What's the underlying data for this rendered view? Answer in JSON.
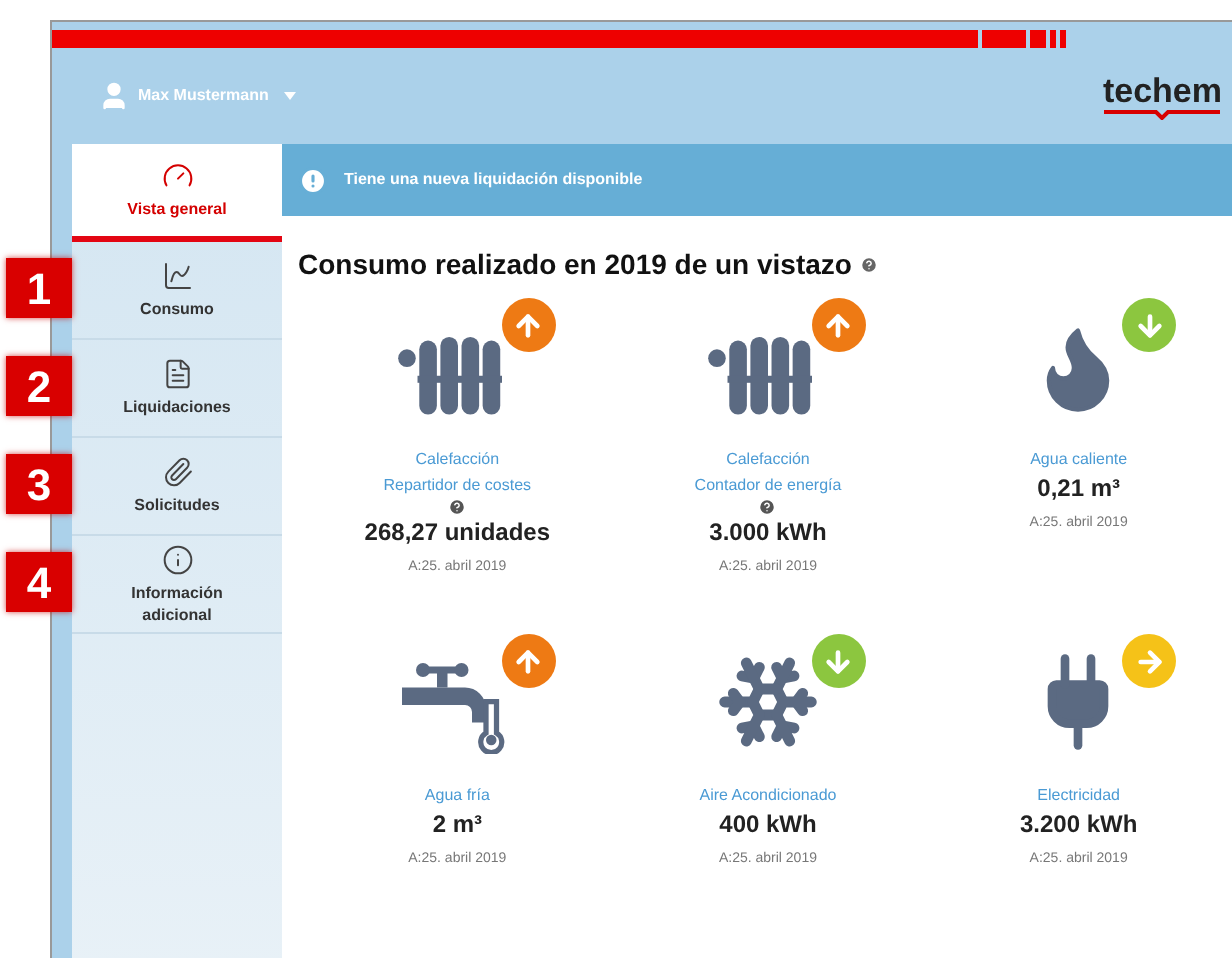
{
  "header": {
    "user": "Max Mustermann",
    "logo": "techem"
  },
  "sidebar": {
    "items": [
      {
        "label": "Vista general",
        "selected": true
      },
      {
        "label": "Consumo",
        "selected": false,
        "marker": "1"
      },
      {
        "label": "Liquidaciones",
        "selected": false,
        "marker": "2"
      },
      {
        "label": "Solicitudes",
        "selected": false,
        "marker": "3"
      },
      {
        "label": "Información adicional",
        "selected": false,
        "marker": "4"
      }
    ]
  },
  "notice": "Tiene una nueva liquidación disponible",
  "title": "Consumo realizado en 2019 de un vistazo",
  "tiles": [
    {
      "kind": "radiator",
      "badge": {
        "kind": "up",
        "color": "#ee7a14"
      },
      "labels": [
        "Calefacción",
        "Repartidor de costes"
      ],
      "help": true,
      "value": "268,27 unidades",
      "date": "A:25. abril 2019"
    },
    {
      "kind": "radiator",
      "badge": {
        "kind": "up",
        "color": "#ee7a14"
      },
      "labels": [
        "Calefacción",
        "Contador de energía"
      ],
      "help": true,
      "value": "3.000 kWh",
      "date": "A:25. abril 2019"
    },
    {
      "kind": "flame",
      "badge": {
        "kind": "down",
        "color": "#8cc63f"
      },
      "labels": [
        "Agua caliente"
      ],
      "help": false,
      "value": "0,21 m³",
      "date": "A:25. abril 2019"
    },
    {
      "kind": "tap",
      "badge": {
        "kind": "up",
        "color": "#ee7a14"
      },
      "labels": [
        "Agua fría"
      ],
      "help": false,
      "value": "2 m³",
      "date": "A:25. abril 2019"
    },
    {
      "kind": "snowflake",
      "badge": {
        "kind": "down",
        "color": "#8cc63f"
      },
      "labels": [
        "Aire Acondicionado"
      ],
      "help": false,
      "value": "400 kWh",
      "date": "A:25. abril 2019"
    },
    {
      "kind": "plug",
      "badge": {
        "kind": "right",
        "color": "#f5c218"
      },
      "labels": [
        "Electricidad"
      ],
      "help": false,
      "value": "3.200 kWh",
      "date": "A:25. abril 2019"
    }
  ]
}
